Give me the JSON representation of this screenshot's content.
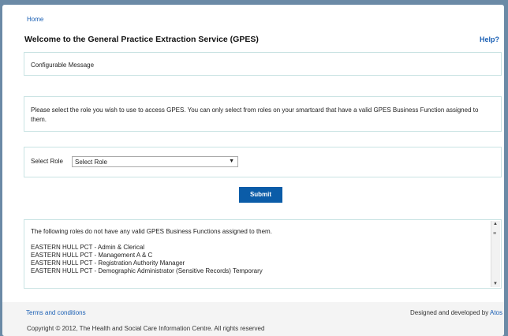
{
  "nav": {
    "home": "Home",
    "help": "Help?"
  },
  "page": {
    "title": "Welcome to the General Practice Extraction Service (GPES)"
  },
  "message": "Configurable Message",
  "info": "Please select the role you wish to use to access GPES. You can only select from roles on your smartcard that have a valid GPES Business Function assigned to them.",
  "role": {
    "label": "Select Role",
    "selected": "Select Role"
  },
  "submit": "Submit",
  "invalid_roles": {
    "intro": "The following roles do not have any valid GPES Business Functions assigned to them.",
    "items": [
      "EASTERN HULL PCT - Admin & Clerical",
      "EASTERN HULL PCT - Management A & C",
      "EASTERN HULL PCT - Registration Authority Manager",
      "EASTERN HULL PCT - Demographic Administrator (Sensitive Records) Temporary"
    ]
  },
  "footer": {
    "terms": "Terms and conditions",
    "designed": "Designed and developed by",
    "designer": "Atos",
    "copyright": "Copyright © 2012, The Health and Social Care Information Centre. All rights reserved"
  }
}
